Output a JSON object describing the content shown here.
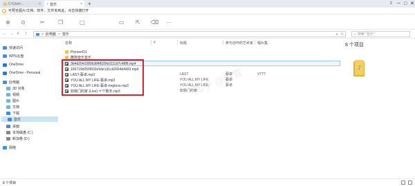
{
  "tabs": [
    {
      "label": "C:\\User\\...",
      "close": "×"
    },
    {
      "label": "音乐",
      "close": "×"
    }
  ],
  "new_tab": "+",
  "window": {
    "badge": "2",
    "minimize": "─",
    "maximize": "□",
    "close": "✕"
  },
  "notice": {
    "text": "可预览图片/文档、软件、文件夹到此，点击快捷打开"
  },
  "nav": {
    "back": "←",
    "forward": "→",
    "recent": "∨",
    "up": "↑"
  },
  "address": {
    "crumbs": [
      "此电脑",
      "音乐"
    ],
    "sep": ">",
    "dropdown": "∨",
    "refresh": "↻"
  },
  "search": {
    "placeholder": "搜索 \"音乐\""
  },
  "sidebar": {
    "items": [
      {
        "label": "快速访问",
        "icon": "star-icon",
        "color": "#3a8ee6"
      },
      {
        "label": "WPS云盘",
        "icon": "cloud-icon",
        "color": "#3a8ee6"
      },
      {
        "label": "OneDrive",
        "icon": "cloud-icon",
        "color": "#2a78d0"
      },
      {
        "label": "OneDrive - Personal",
        "icon": "cloud-icon",
        "color": "#2a78d0"
      },
      {
        "label": "此电脑",
        "icon": "computer-icon",
        "color": "#4a90d0"
      },
      {
        "label": "3D 对象",
        "icon": "cube-icon",
        "color": "#6fb3e6"
      },
      {
        "label": "视频",
        "icon": "video-icon",
        "color": "#6fb3e6"
      },
      {
        "label": "图片",
        "icon": "image-icon",
        "color": "#6fb3e6"
      },
      {
        "label": "文档",
        "icon": "document-icon",
        "color": "#6fb3e6"
      },
      {
        "label": "下载",
        "icon": "download-icon",
        "color": "#3a8ee6"
      },
      {
        "label": "音乐",
        "icon": "music-icon",
        "color": "#3a8ee6"
      },
      {
        "label": "桌面",
        "icon": "desktop-icon",
        "color": "#3a8ee6"
      },
      {
        "label": "本地磁盘 (C:)",
        "icon": "drive-icon",
        "color": "#888888"
      },
      {
        "label": "新加卷 (D:)",
        "icon": "drive-icon",
        "color": "#888888"
      },
      {
        "label": "网络",
        "icon": "network-icon",
        "color": "#3a8ee6"
      }
    ]
  },
  "columns": [
    "名称",
    "#",
    "标题",
    "参与创作的艺术家",
    "唱片集"
  ],
  "files": [
    {
      "name": "PioneerDJ",
      "type": "folder",
      "num": "",
      "title": "",
      "artist": "",
      "album": ""
    },
    {
      "name": "酷狗音乐音乐",
      "type": "folder",
      "num": "",
      "title": "",
      "artist": "",
      "album": ""
    },
    {
      "name": "3b4d2041080b384f525fc0111d7c48f8.mp4",
      "type": "file",
      "num": "",
      "title": "",
      "artist": "",
      "album": ""
    },
    {
      "name": "166719d255f502e5de1d1cd2664d4493.mp4",
      "type": "file",
      "num": "",
      "title": "",
      "artist": "",
      "album": ""
    },
    {
      "name": "LAST-蔡卓.mp3",
      "type": "file",
      "num": "",
      "title": "LAST",
      "artist": "蔡卓",
      "album": "VTTT"
    },
    {
      "name": "YOU ALL MY LIFE-蔡卓.mp3",
      "type": "file",
      "num": "",
      "title": "YOU ALL MY LIFE",
      "artist": "蔡卓",
      "album": ""
    },
    {
      "name": "YOU ALL MY LIFE-蔡卓-ringtone.mp3",
      "type": "file",
      "num": "",
      "title": "YOU ALL MY LIFE",
      "artist": "蔡卓",
      "album": ""
    },
    {
      "name": "如我门的家 (Live)-十个数天.mp3",
      "type": "file",
      "num": "",
      "title": "如我门的家",
      "artist": "",
      "album": ""
    }
  ],
  "details": {
    "count": "8 个项目"
  },
  "status": {
    "count": "8 个项目"
  },
  "watermark": "知乎 @翻雪"
}
